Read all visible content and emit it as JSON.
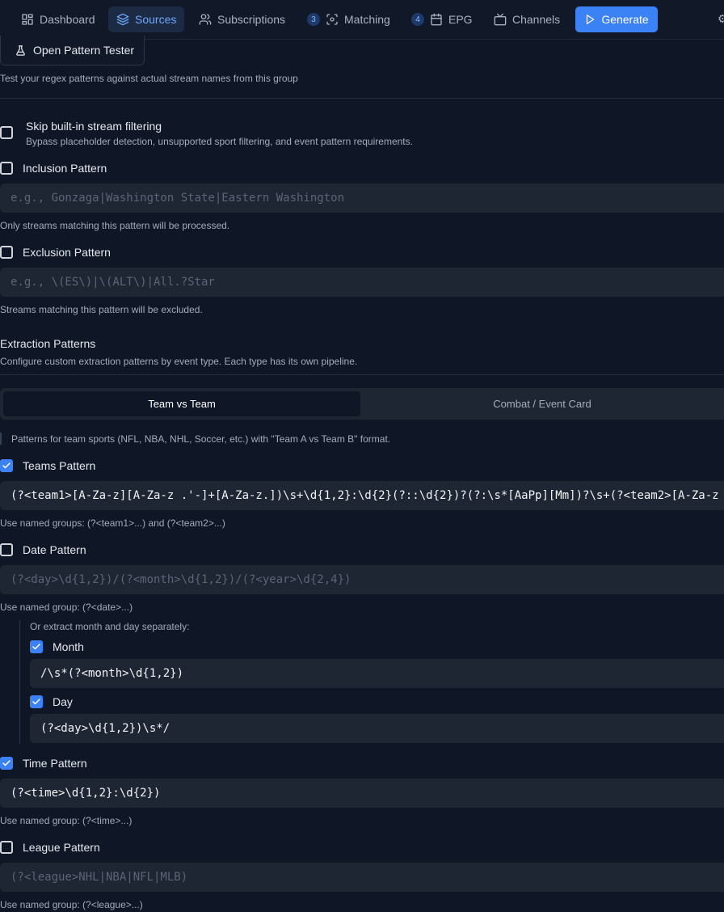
{
  "nav": {
    "items": [
      {
        "label": "Dashboard",
        "icon": "dashboard-icon"
      },
      {
        "label": "Sources",
        "icon": "layers-icon",
        "active": true
      },
      {
        "label": "Subscriptions",
        "icon": "users-icon"
      },
      {
        "label": "Matching",
        "icon": "scan-icon",
        "badge": "3"
      },
      {
        "label": "EPG",
        "icon": "calendar-icon",
        "badge": "4"
      },
      {
        "label": "Channels",
        "icon": "tv-icon"
      }
    ],
    "generate_label": "Generate",
    "accent": "#3b82f6"
  },
  "tester": {
    "button_label": "Open Pattern Tester",
    "help": "Test your regex patterns against actual stream names from this group"
  },
  "skip_filter": {
    "label": "Skip built-in stream filtering",
    "description": "Bypass placeholder detection, unsupported sport filtering, and event pattern requirements.",
    "checked": false
  },
  "inclusion": {
    "label": "Inclusion Pattern",
    "checked": false,
    "placeholder": "e.g., Gonzaga|Washington State|Eastern Washington",
    "help": "Only streams matching this pattern will be processed."
  },
  "exclusion": {
    "label": "Exclusion Pattern",
    "checked": false,
    "placeholder": "e.g., \\(ES\\)|\\(ALT\\)|All.?Star",
    "help": "Streams matching this pattern will be excluded."
  },
  "extraction": {
    "title": "Extraction Patterns",
    "description": "Configure custom extraction patterns by event type. Each type has its own pipeline.",
    "tabs": [
      "Team vs Team",
      "Combat / Event Card"
    ],
    "note": "Patterns for team sports (NFL, NBA, NHL, Soccer, etc.) with \"Team A vs Team B\" format."
  },
  "teams": {
    "label": "Teams Pattern",
    "checked": true,
    "value": "(?<team1>[A-Za-z][A-Za-z .'-]+[A-Za-z.])\\s+\\d{1,2}:\\d{2}(?::\\d{2})?(?:\\s*[AaPp][Mm])?\\s+(?<team2>[A-Za-z",
    "help": "Use named groups: (?<team1>...) and (?<team2>...)"
  },
  "date": {
    "label": "Date Pattern",
    "checked": false,
    "placeholder": "(?<day>\\d{1,2})/(?<month>\\d{1,2})/(?<year>\\d{2,4})",
    "help": "Use named group: (?<date>...)",
    "separate_label": "Or extract month and day separately:",
    "month": {
      "label": "Month",
      "checked": true,
      "value": "/\\s*(?<month>\\d{1,2})"
    },
    "day": {
      "label": "Day",
      "checked": true,
      "value": "(?<day>\\d{1,2})\\s*/"
    }
  },
  "time": {
    "label": "Time Pattern",
    "checked": true,
    "value": "(?<time>\\d{1,2}:\\d{2})",
    "help": "Use named group: (?<time>...)"
  },
  "league": {
    "label": "League Pattern",
    "checked": false,
    "placeholder": "(?<league>NHL|NBA|NFL|MLB)",
    "help": "Use named group: (?<league>...)"
  }
}
